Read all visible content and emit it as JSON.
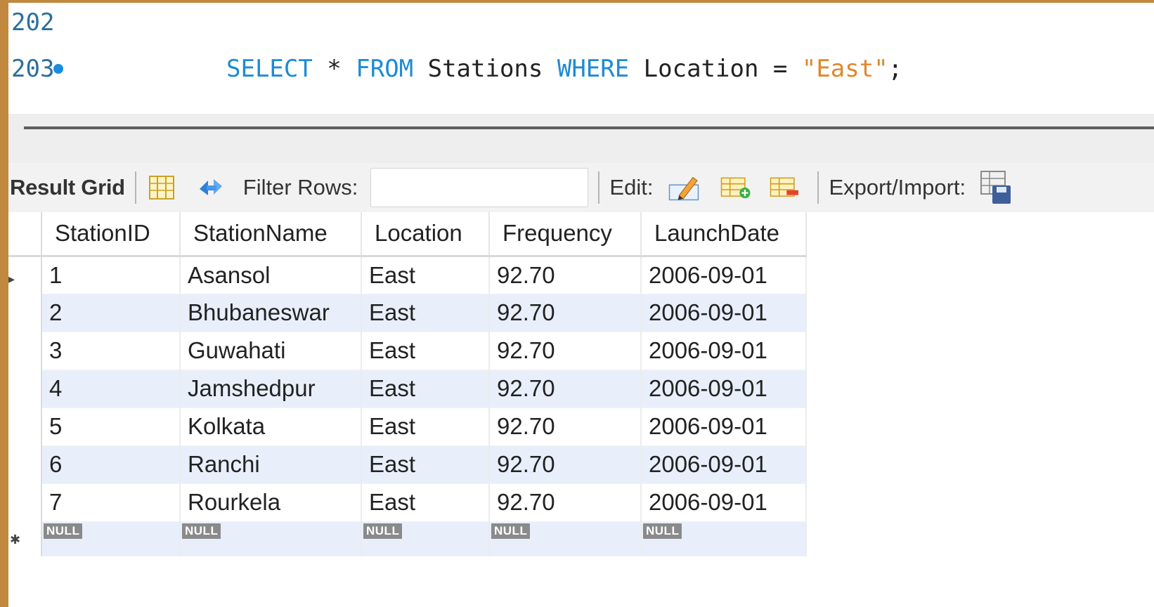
{
  "editor": {
    "lines": [
      {
        "number": "202"
      },
      {
        "number": "203",
        "tokens": {
          "select": "SELECT",
          "star": " * ",
          "from": "FROM",
          "table": " Stations ",
          "where": "WHERE",
          "cond": " Location = ",
          "value": "\"East\"",
          "end": ";"
        }
      }
    ]
  },
  "colors": {
    "keyword": "#1e8ad6",
    "string": "#e0872b",
    "line_number": "#2a6f9e",
    "alt_row": "#e8effb",
    "frame": "#c0893f"
  },
  "toolbar": {
    "result_grid_label": "Result Grid",
    "filter_rows_label": "Filter Rows:",
    "filter_value": "",
    "edit_label": "Edit:",
    "export_import_label": "Export/Import:"
  },
  "grid": {
    "columns": [
      "StationID",
      "StationName",
      "Location",
      "Frequency",
      "LaunchDate"
    ],
    "rows": [
      [
        "1",
        "Asansol",
        "East",
        "92.70",
        "2006-09-01"
      ],
      [
        "2",
        "Bhubaneswar",
        "East",
        "92.70",
        "2006-09-01"
      ],
      [
        "3",
        "Guwahati",
        "East",
        "92.70",
        "2006-09-01"
      ],
      [
        "4",
        "Jamshedpur",
        "East",
        "92.70",
        "2006-09-01"
      ],
      [
        "5",
        "Kolkata",
        "East",
        "92.70",
        "2006-09-01"
      ],
      [
        "6",
        "Ranchi",
        "East",
        "92.70",
        "2006-09-01"
      ],
      [
        "7",
        "Rourkela",
        "East",
        "92.70",
        "2006-09-01"
      ]
    ],
    "null_label": "NULL",
    "current_row_marker": "▸",
    "new_row_marker": "✱"
  }
}
